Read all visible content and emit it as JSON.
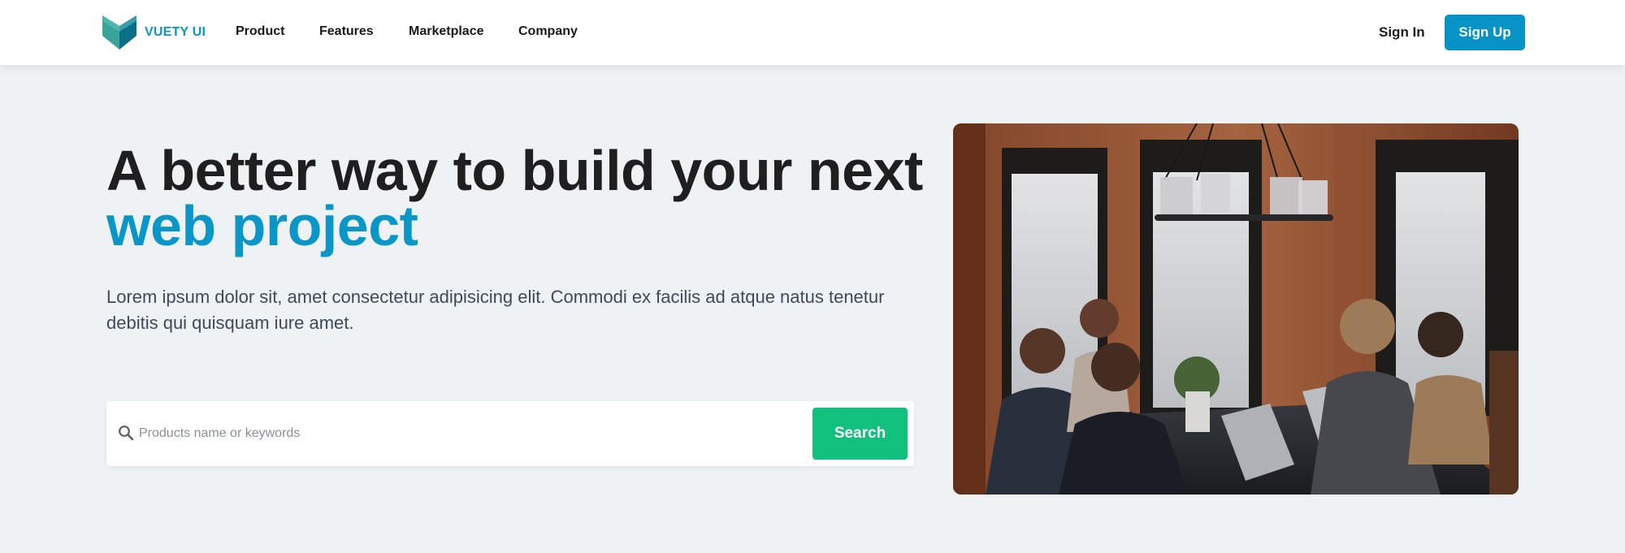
{
  "colors": {
    "brand": "#0b96c8",
    "brand_button": "#0893c6",
    "search_button": "#11c07c",
    "title_dark": "#1f1f1f",
    "title_accent": "#0b96c8"
  },
  "logo": {
    "text": "VUETY UI",
    "icon": "vuety-logo-icon"
  },
  "nav": {
    "links": [
      {
        "label": "Product"
      },
      {
        "label": "Features"
      },
      {
        "label": "Marketplace"
      },
      {
        "label": "Company"
      }
    ],
    "sign_in": "Sign In",
    "sign_up": "Sign Up"
  },
  "hero": {
    "title_line1": "A better way to build your next",
    "title_line2": "web project",
    "subtitle_line1": "Lorem ipsum dolor sit, amet consectetur adipisicing elit. Commodi ex facilis ad atque natus tenetur",
    "subtitle_line2": "debitis qui quisquam iure amet.",
    "search": {
      "icon": "search-icon",
      "placeholder": "Products name or keywords",
      "value": "",
      "button_label": "Search"
    },
    "image": {
      "subject": "team-meeting-photo"
    }
  }
}
